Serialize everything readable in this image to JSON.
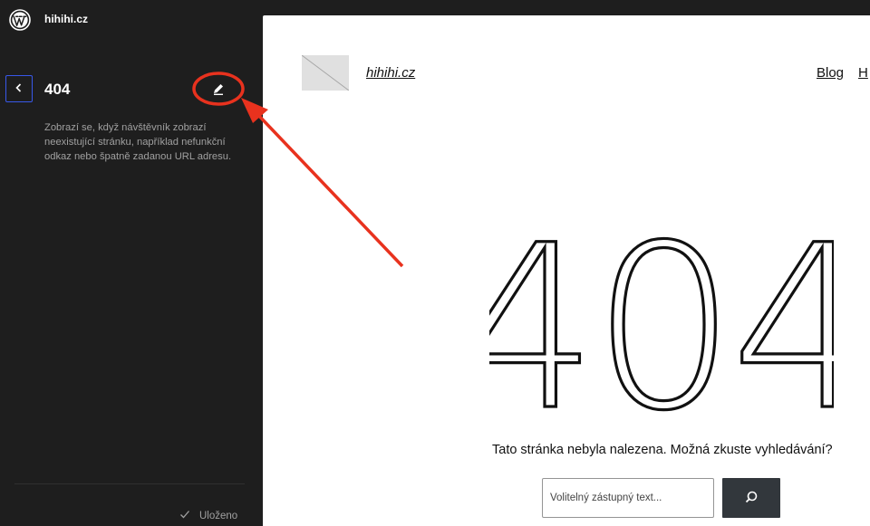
{
  "header": {
    "site_name": "hihihi.cz",
    "logo_icon": "wordpress-logo-icon"
  },
  "panel": {
    "back_icon": "chevron-left-icon",
    "title": "404",
    "edit_icon": "pencil-icon",
    "description": "Zobrazí se, když návštěvník zobrazí neexistující stránku, například nefunkční odkaz nebo špatně zadanou URL adresu."
  },
  "footer": {
    "status_icon": "check-icon",
    "status_label": "Uloženo"
  },
  "preview": {
    "site_title": "hihihi.cz",
    "nav_items": [
      "Blog",
      "H"
    ],
    "heading": "404",
    "message": "Tato stránka nebyla nalezena. Možná zkuste vyhledávání?",
    "search_placeholder": "Volitelný zástupný text...",
    "search_icon": "search-icon"
  },
  "colors": {
    "sidebar_bg": "#1e1e1e",
    "accent": "#3858e9",
    "annotation": "#e8321e",
    "button_dark": "#32373c"
  }
}
